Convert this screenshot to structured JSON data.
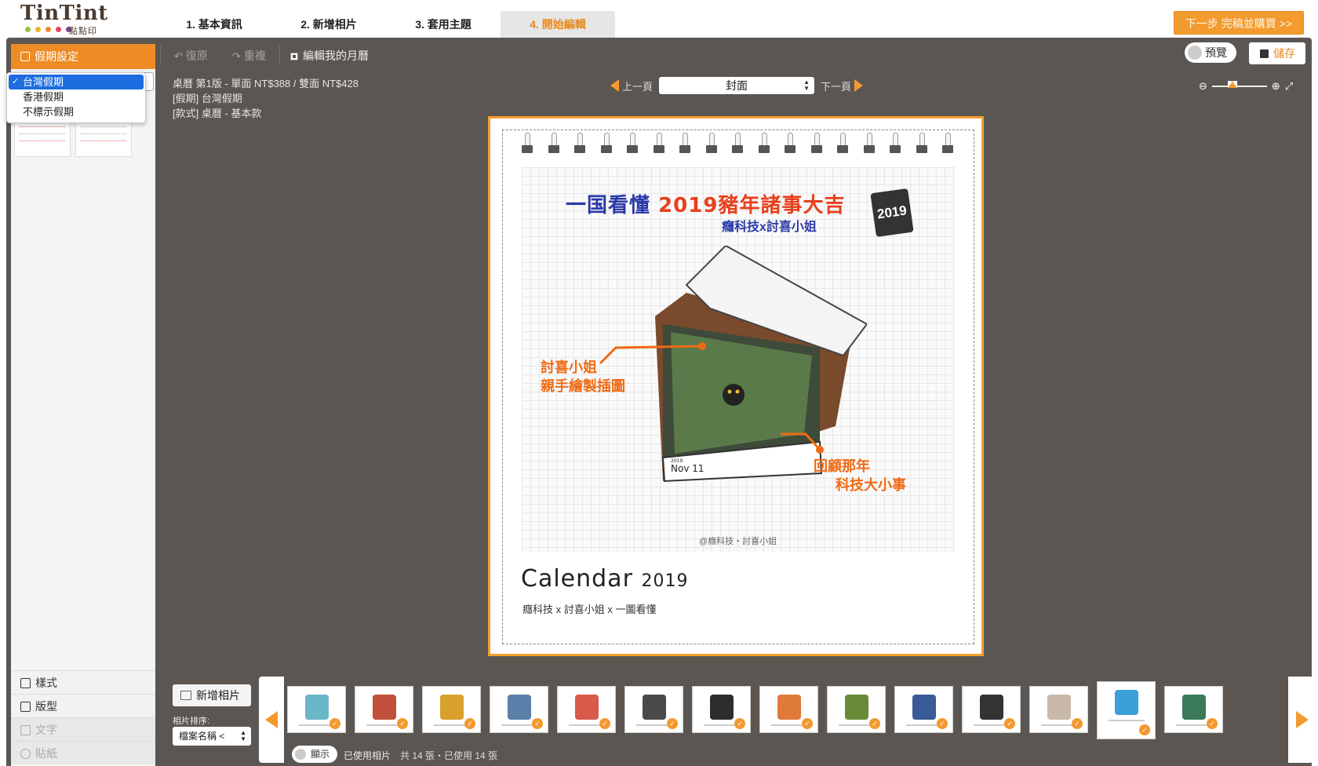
{
  "logo": {
    "name": "TinTint",
    "sub": "點點印",
    "dot_colors": [
      "#9ac33c",
      "#f0b52b",
      "#e8892c",
      "#e2475f",
      "#7d3f8c"
    ]
  },
  "steps": [
    {
      "label": "1. 基本資訊"
    },
    {
      "label": "2. 新增相片"
    },
    {
      "label": "3. 套用主題"
    },
    {
      "label": "4. 開始編輯"
    }
  ],
  "next_button": "下一步 完稿並購買 >>",
  "left_panel": {
    "header": "假期設定",
    "holiday_options": [
      "台灣假期",
      "香港假期",
      "不標示假期"
    ],
    "selected_holiday": "台灣假期",
    "tabs": [
      "樣式",
      "版型",
      "文字",
      "貼紙"
    ]
  },
  "toolbar": {
    "undo": "復原",
    "redo": "重複",
    "edit_my_calendar": "編輯我的月曆",
    "preview": "預覽",
    "save": "儲存"
  },
  "info": {
    "line1": "桌曆 第1版 - 單面 NT$388 / 雙面 NT$428",
    "line2": "[假期] 台灣假期",
    "line3": "[款式] 桌曆 - 基本款"
  },
  "pager": {
    "prev": "上一頁",
    "current": "封面",
    "next": "下一頁"
  },
  "calendar_page": {
    "art_title_a": "一国看懂",
    "art_title_b": "2019豬年諸事大吉",
    "art_badge": "2019",
    "art_subtitle": "癮科技x討喜小姐",
    "annotation_left": [
      "討喜小姐",
      "親手繪製插圖"
    ],
    "annotation_right": [
      "回顧那年",
      "科技大小事"
    ],
    "art_credit": "@癮科技・討喜小姐",
    "desk_month": "Nov 11",
    "desk_year": "2019",
    "title": "Calendar",
    "title_year": "2019",
    "subtitle": "癮科技 x 討喜小姐 x 一圖看懂"
  },
  "bottom": {
    "add_photo": "新增相片",
    "sort_label": "相片排序:",
    "sort_value": "檔案名稱 <",
    "show_toggle": "顯示",
    "used_label": "已使用相片",
    "count_text": "共 14 張・已使用 14 張",
    "thumb_colors": [
      "#6ab7c9",
      "#c0503a",
      "#d9a02c",
      "#5a7fa8",
      "#d75a4a",
      "#4a4a4a",
      "#2d2d2d",
      "#e07a3a",
      "#6a8a3a",
      "#3a5a9a",
      "#333333",
      "#c9b9a9",
      "#3aa0d8",
      "#3a7a5a"
    ]
  }
}
